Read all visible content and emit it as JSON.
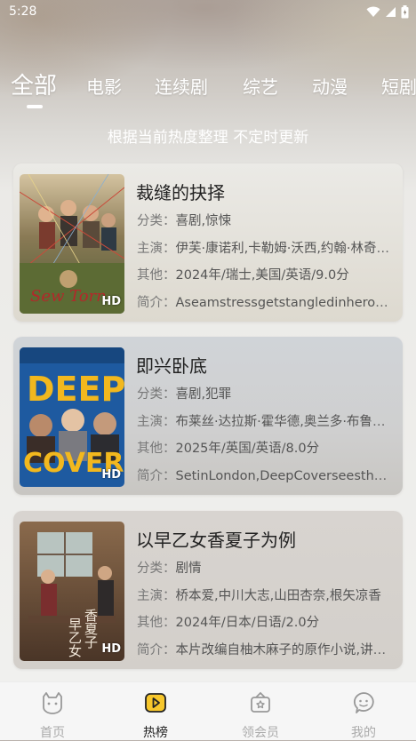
{
  "status_bar": {
    "time": "5:28",
    "icons": [
      "wifi-icon",
      "signal-icon",
      "battery-icon"
    ]
  },
  "tabs": [
    {
      "label": "全部",
      "active": true
    },
    {
      "label": "电影"
    },
    {
      "label": "连续剧"
    },
    {
      "label": "综艺"
    },
    {
      "label": "动漫"
    },
    {
      "label": "短剧"
    }
  ],
  "subtitle": "根据当前热度整理 不定时更新",
  "movies": [
    {
      "title": "裁缝的抉择",
      "category_key": "分类：",
      "category": "喜剧,惊悚",
      "cast_key": "主演：",
      "cast": "伊芙·康诺利,卡勒姆·沃西,约翰·林奇,伊恩·奥瑞利",
      "other_key": "其他：",
      "other": "2024年/瑞士,美国/英语/9.0分",
      "summary_key": "简介：",
      "summary": "Aseamstressgetstangledinherownweb",
      "badge": "HD",
      "poster_text": "Sew Torn",
      "poster_colors": [
        "#6b6a3a",
        "#b9975b",
        "#2f3b2a"
      ]
    },
    {
      "title": "即兴卧底",
      "category_key": "分类：",
      "category": "喜剧,犯罪",
      "cast_key": "主演：",
      "cast": "布莱丝·达拉斯·霍华德,奥兰多·布鲁姆,尼克·弗罗斯特",
      "other_key": "其他：",
      "other": "2025年/英国/英语/8.0分",
      "summary_key": "简介：",
      "summary": "SetinLondon,DeepCoverseesthreeimprov",
      "badge": "HD",
      "poster_text": "DEEP COVER",
      "poster_colors": [
        "#1f5fa8",
        "#f2b81e",
        "#12325c"
      ]
    },
    {
      "title": "以早乙女香夏子为例",
      "category_key": "分类：",
      "category": "剧情",
      "cast_key": "主演：",
      "cast": "桥本爱,中川大志,山田杏奈,根矢凉香",
      "other_key": "其他：",
      "other": "2024年/日本/日语/2.0分",
      "summary_key": "简介：",
      "summary": "本片改编自柚木麻子的原作小说,讲述了",
      "badge": "HD",
      "poster_text": "早乙女香夏子",
      "poster_colors": [
        "#6d4a33",
        "#c49a6c",
        "#3c2a20"
      ]
    }
  ],
  "bottom_nav": [
    {
      "label": "首页",
      "icon": "home-icon",
      "active": false
    },
    {
      "label": "热榜",
      "icon": "hot-list-icon",
      "active": true
    },
    {
      "label": "领会员",
      "icon": "vip-icon",
      "active": false
    },
    {
      "label": "我的",
      "icon": "profile-icon",
      "active": false
    }
  ],
  "colors": {
    "accent": "#f7c72c",
    "card_text": "#222222",
    "muted": "#aaaaaa"
  }
}
